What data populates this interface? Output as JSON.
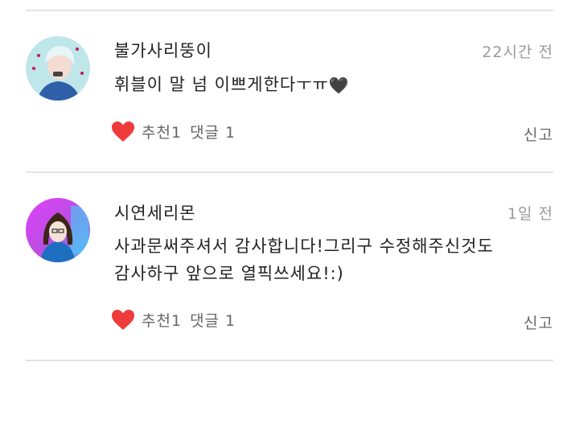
{
  "comments": [
    {
      "username": "불가사리뚱이",
      "time": "22시간 전",
      "lines": [
        "휘블이 말 넘 이쁘게한다ㅜㅠ"
      ],
      "trailing_emoji": "🖤",
      "like_label": "추천1",
      "reply_label": "댓글 1",
      "report_label": "신고",
      "avatar_colors": {
        "bg": "#bfe6e8",
        "hair": "#d9f0f5",
        "face": "#f3dcd2",
        "shirt": "#2e5fa8",
        "accent": "#c2185b"
      }
    },
    {
      "username": "시연세리몬",
      "time": "1일 전",
      "lines": [
        "사과문써주셔서 감사합니다!그리구 수정해주신것도",
        "감사하구 앞으로 열픽쓰세요!:)"
      ],
      "trailing_emoji": "",
      "like_label": "추천1",
      "reply_label": "댓글 1",
      "report_label": "신고",
      "avatar_colors": {
        "bg": "#e040fb",
        "bg2": "#4fc3f7",
        "hair": "#3b2418",
        "face": "#f6e3d8",
        "shirt": "#1f6fc0"
      }
    }
  ],
  "colors": {
    "heart": "#ef3b3b",
    "divider": "#e3e3e3",
    "muted": "#9a9a9a"
  }
}
